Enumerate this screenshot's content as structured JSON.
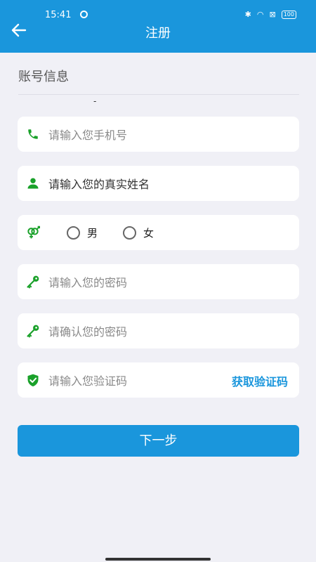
{
  "status_bar": {
    "time": "15:41",
    "battery": "100"
  },
  "header": {
    "title": "注册"
  },
  "section": {
    "title": "账号信息",
    "marker": "-"
  },
  "form": {
    "phone_placeholder": "请输入您手机号",
    "name_value": "请输入您的真实姓名",
    "gender": {
      "options": [
        "男",
        "女"
      ]
    },
    "password_placeholder": "请输入您的密码",
    "confirm_password_placeholder": "请确认您的密码",
    "code_placeholder": "请输入您验证码",
    "get_code_label": "获取验证码"
  },
  "next_button": {
    "label": "下一步"
  },
  "colors": {
    "primary": "#1a96dc",
    "icon_green": "#1aa12a",
    "background": "#f0f0f6"
  },
  "icons": [
    "arrow-left-icon",
    "phone-icon",
    "person-icon",
    "gender-icon",
    "key-icon",
    "shield-check-icon"
  ]
}
